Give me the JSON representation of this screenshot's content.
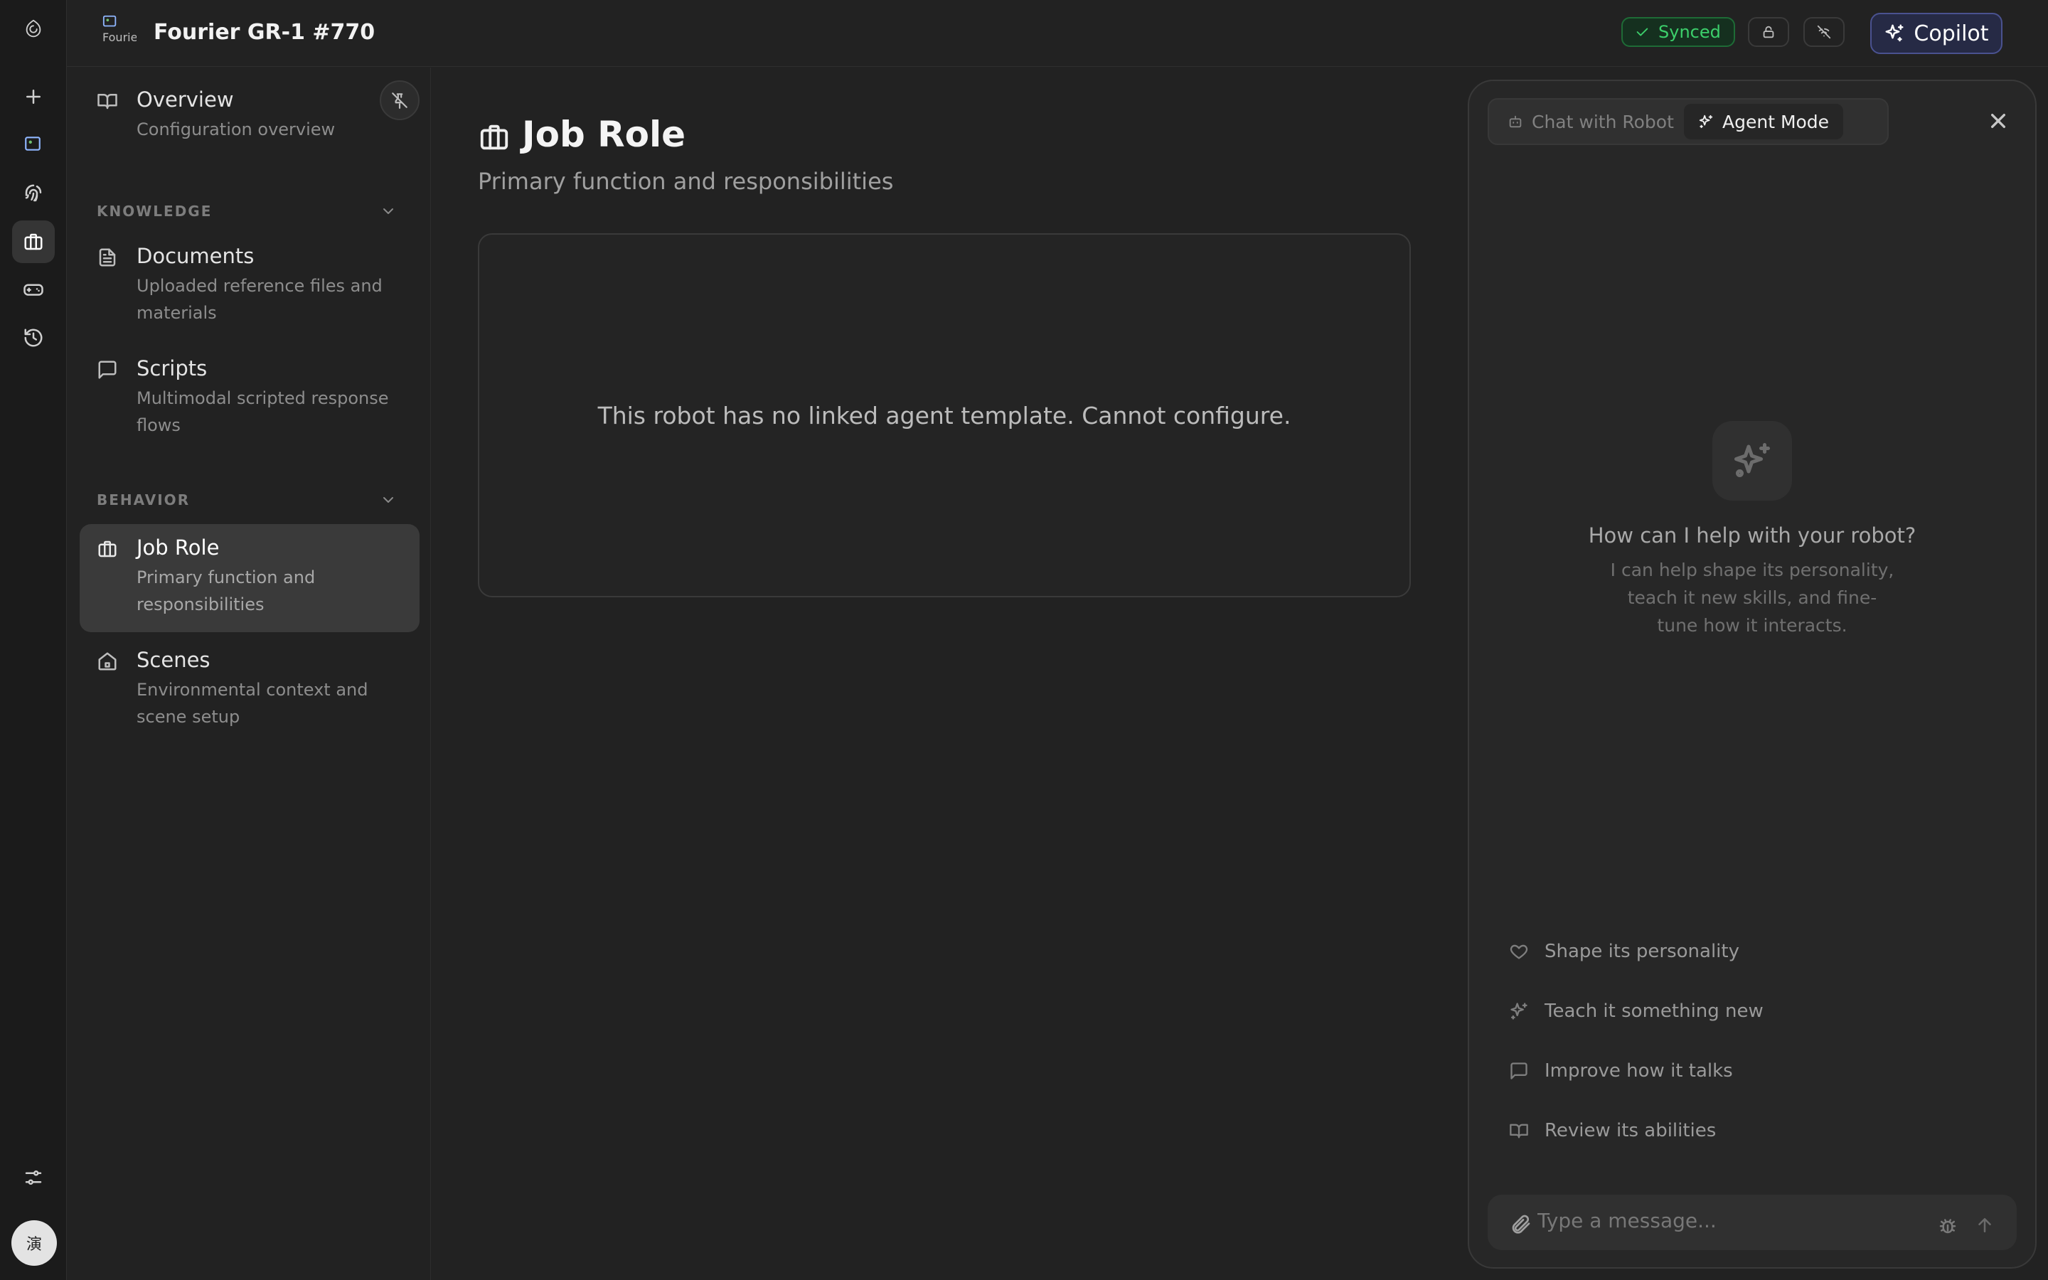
{
  "header": {
    "robot_name": "Fourier GR-1 #770",
    "robot_image_alt": "Fourier",
    "sync_status": "Synced"
  },
  "rail": {
    "avatar_initial": "演",
    "items": [
      "new-icon",
      "robot-avatar",
      "fingerprint-icon",
      "briefcase-icon",
      "gamepad-icon",
      "history-icon",
      "sliders-icon"
    ]
  },
  "sidebar": {
    "overview": {
      "title": "Overview",
      "desc": "Configuration overview"
    },
    "sections": {
      "knowledge": "KNOWLEDGE",
      "behavior": "BEHAVIOR"
    },
    "items": {
      "documents": {
        "title": "Documents",
        "desc": "Uploaded reference files and materials"
      },
      "scripts": {
        "title": "Scripts",
        "desc": "Multimodal scripted response flows"
      },
      "job_role": {
        "title": "Job Role",
        "desc": "Primary function and responsibilities"
      },
      "scenes": {
        "title": "Scenes",
        "desc": "Environmental context and scene setup"
      }
    }
  },
  "main": {
    "title": "Job Role",
    "subtitle": "Primary function and responsibilities",
    "empty_message": "This robot has no linked agent template. Cannot configure."
  },
  "copilot": {
    "button_label": "Copilot",
    "tabs": {
      "chat": "Chat with Robot",
      "agent": "Agent Mode"
    },
    "active_tab": "agent",
    "welcome_title": "How can I help with your robot?",
    "welcome_desc": "I can help shape its personality, teach it new skills, and fine-tune how it interacts.",
    "suggestions": {
      "personality": "Shape its personality",
      "teach": "Teach it something new",
      "talk": "Improve how it talks",
      "abilities": "Review its abilities"
    },
    "composer_placeholder": "Type a message..."
  },
  "colors": {
    "background": "#222222",
    "rail": "#1b1b1b",
    "synced_green": "#3ccf6b",
    "copilot_accent": "#4a5290"
  }
}
